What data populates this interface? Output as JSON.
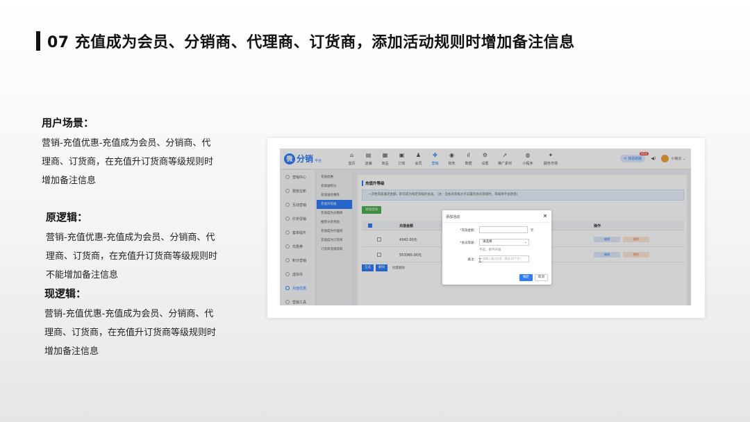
{
  "slide": {
    "title": "07 充值成为会员、分销商、代理商、订货商，添加活动规则时增加备注信息"
  },
  "scenario": {
    "heading": "用户场景：",
    "lines": [
      "营销-充值优惠-充值成为会员、分销商、代",
      "理商、订货商，在充值升订货商等级规则时",
      "增加备注信息"
    ]
  },
  "old_logic": {
    "heading": "原逻辑：",
    "lines": [
      "营销-充值优惠-充值成为会员、分销商、代",
      "理商、订货商，在充值升订货商等级规则时",
      "不能增加备注信息"
    ]
  },
  "new_logic": {
    "heading": "现逻辑：",
    "lines": [
      "营销-充值优惠-充值成为会员、分销商、代",
      "理商、订货商，在充值升订货商等级规则时",
      "增加备注信息"
    ]
  },
  "screenshot": {
    "logo": {
      "mark": "微",
      "text": "分销",
      "sub": "平台"
    },
    "nav": [
      {
        "icon": "⌂",
        "label": "首页"
      },
      {
        "icon": "▤",
        "label": "店铺"
      },
      {
        "icon": "▦",
        "label": "商品"
      },
      {
        "icon": "▣",
        "label": "订单"
      },
      {
        "icon": "♟",
        "label": "会员"
      },
      {
        "icon": "✤",
        "label": "营销"
      },
      {
        "icon": "◉",
        "label": "财务"
      },
      {
        "icon": "ıl",
        "label": "数据"
      },
      {
        "icon": "⚙",
        "label": "设置"
      },
      {
        "icon": "➚",
        "label": "推广素材"
      },
      {
        "icon": "◍",
        "label": "小程序"
      },
      {
        "icon": "✦",
        "label": "服务市场"
      }
    ],
    "right": {
      "pill": "✐ 体验新版",
      "badge": "NEW",
      "volume_icon": "◀)",
      "user": "小萌云 ⌄"
    },
    "sidebar": [
      "营销中心",
      "裂变拉新",
      "互动营销",
      "打折促销",
      "套单提升",
      "优惠券",
      "积分营销",
      "虚拟币",
      "充值优惠",
      "营销工具"
    ],
    "subside": [
      "充值优惠",
      "充值送积分",
      "充值送优惠券",
      "充值升等级",
      "充值成为分销商",
      "推荐分享奖励",
      "充值成为代理商",
      "充值成为订货商",
      "订货商充值获取"
    ],
    "content": {
      "title": "充值升等级",
      "notice": "一次性充值满足金额，即可成为指定等级的会员。（注：当会员等级大于设置的会员等级时，等级将不会改变）",
      "add_button": "添加活动",
      "table_headers": {
        "amount": "充值金额",
        "ops": "操作"
      },
      "rows": [
        {
          "amount": "4342.00元",
          "edit": "编辑",
          "del": "删除"
        },
        {
          "amount": "553365.00元",
          "edit": "编辑",
          "del": "删除"
        }
      ],
      "bottom": {
        "all": "全选",
        "delete": "删除",
        "batch": "批量删除"
      }
    },
    "dialog": {
      "title": "添加活动",
      "close": "×",
      "amount_label": "*充值金额：",
      "unit": "元",
      "level_label": "*会员等级：",
      "level_value": "请选择",
      "hint": "不选，则不升级",
      "note_label": "备注：",
      "note_placeholder": "请输入备注信息（最多10个字）",
      "ok": "确定",
      "cancel": "取消"
    }
  }
}
